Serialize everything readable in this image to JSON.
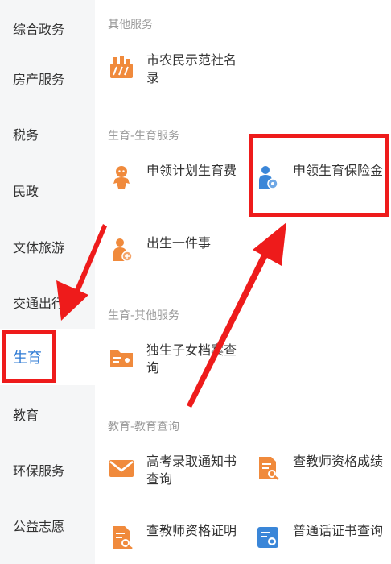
{
  "sidebar": {
    "items": [
      {
        "label": "综合政务"
      },
      {
        "label": "房产服务"
      },
      {
        "label": "税务"
      },
      {
        "label": "民政"
      },
      {
        "label": "文体旅游"
      },
      {
        "label": "交通出行"
      },
      {
        "label": "生育",
        "active": true
      },
      {
        "label": "教育"
      },
      {
        "label": "环保服务"
      },
      {
        "label": "公益志愿"
      }
    ]
  },
  "sections": {
    "other": {
      "title": "其他服务",
      "items": [
        {
          "label": "市农民示范社名录",
          "icon": "building-icon"
        }
      ]
    },
    "birth_service": {
      "title": "生育-生育服务",
      "items": [
        {
          "label": "申领计划生育费",
          "icon": "baby-icon"
        },
        {
          "label": "申领生育保险金",
          "icon": "mother-baby-icon"
        },
        {
          "label": "出生一件事",
          "icon": "newborn-icon"
        }
      ]
    },
    "birth_other": {
      "title": "生育-其他服务",
      "items": [
        {
          "label": "独生子女档案查询",
          "icon": "folder-icon"
        }
      ]
    },
    "education_query": {
      "title": "教育-教育查询",
      "items": [
        {
          "label": "高考录取通知书查询",
          "icon": "envelope-icon"
        },
        {
          "label": "查教师资格成绩",
          "icon": "doc-search-icon"
        },
        {
          "label": "查教师资格证明",
          "icon": "doc-search-icon"
        },
        {
          "label": "普通话证书查询",
          "icon": "certificate-icon"
        }
      ]
    }
  },
  "colors": {
    "accent": "#2f7bd4",
    "icon_orange": "#f08a3c",
    "icon_blue": "#3a86d8",
    "annotation_red": "#ee1b1b"
  }
}
